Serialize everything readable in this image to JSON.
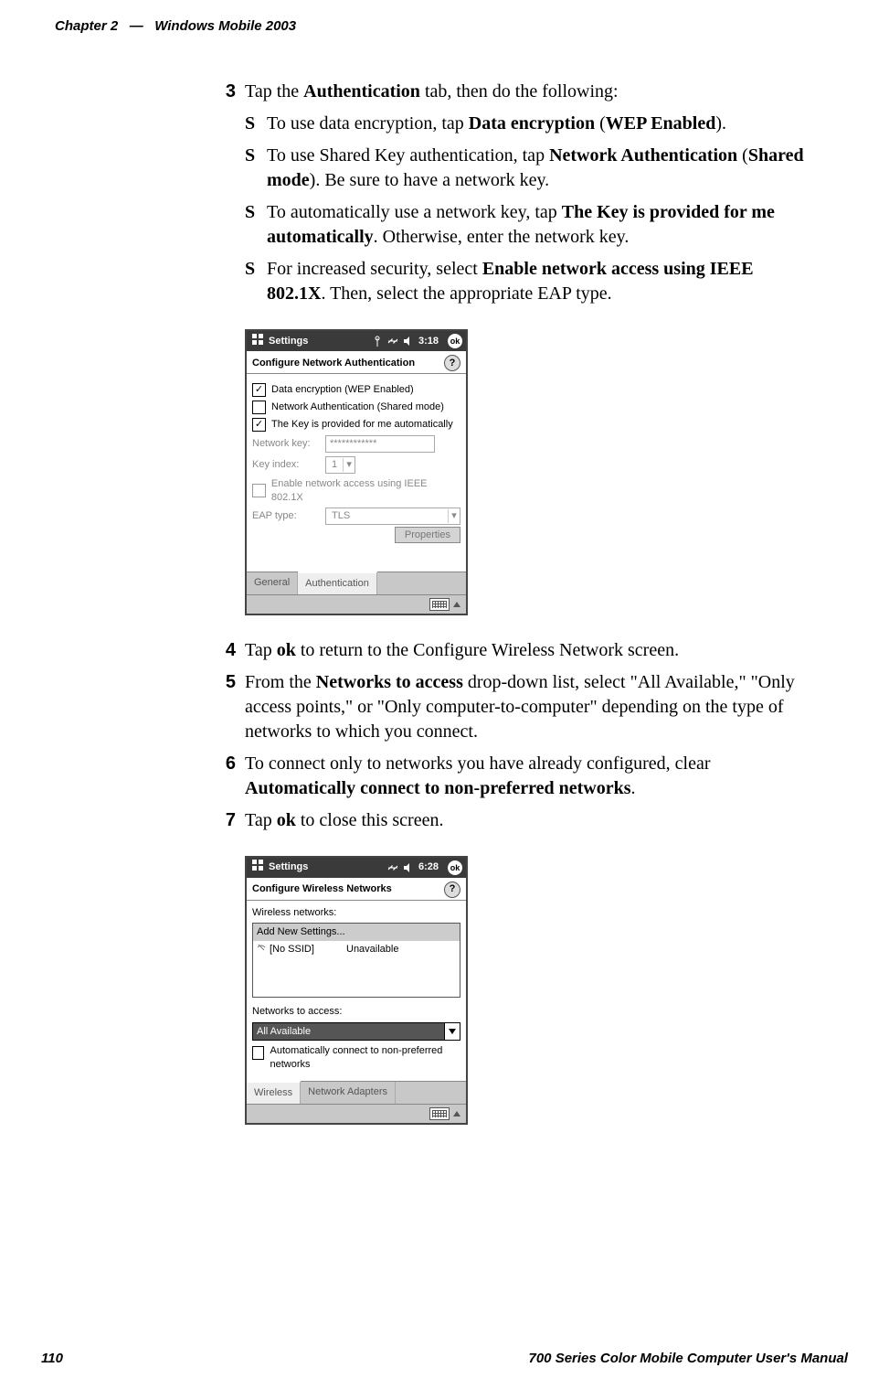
{
  "header": {
    "chapter": "Chapter 2",
    "dash": "—",
    "title": "Windows Mobile 2003"
  },
  "footer": {
    "page": "110",
    "manual": "700 Series Color Mobile Computer User's Manual"
  },
  "steps": {
    "s3": {
      "num": "3",
      "text_a": "Tap the ",
      "text_b": "Authentication",
      "text_c": " tab, then do the following:"
    },
    "s3_sub": {
      "a": {
        "pre": "To use data encryption, tap ",
        "b1": "Data encryption",
        "mid": " (",
        "b2": "WEP Enabled",
        "post": ")."
      },
      "b": {
        "pre": "To use Shared Key authentication, tap ",
        "b1": "Network Authentication",
        "mid": " (",
        "b2": "Shared mode",
        "post": "). Be sure to have a network key."
      },
      "c": {
        "pre": "To automatically use a network key, tap ",
        "b1": "The Key is provided for me automatically",
        "post": ". Otherwise, enter the network key."
      },
      "d": {
        "pre": "For increased security, select ",
        "b1": "Enable network access using IEEE 802.1X",
        "post": ". Then, select the appropriate EAP type."
      }
    },
    "s4": {
      "num": "4",
      "pre": "Tap ",
      "b": "ok",
      "post": " to return to the Configure Wireless Network screen."
    },
    "s5": {
      "num": "5",
      "pre": "From the ",
      "b": "Networks to access",
      "post": " drop-down list, select \"All Available,\" \"Only access points,\" or \"Only computer-to-computer\" depending on the type of networks to which you connect."
    },
    "s6": {
      "num": "6",
      "pre": "To connect only to networks you have already configured, clear ",
      "b": "Automatically connect to non-preferred networks",
      "post": "."
    },
    "s7": {
      "num": "7",
      "pre": "Tap ",
      "b": "ok",
      "post": " to close this screen."
    }
  },
  "shot1": {
    "titlebar": "Settings",
    "time": "3:18",
    "ok": "ok",
    "subheader": "Configure Network Authentication",
    "chk1": "Data encryption (WEP Enabled)",
    "chk2": "Network Authentication (Shared mode)",
    "chk3": "The Key is provided for me automatically",
    "lbl_key": "Network key:",
    "val_key": "************",
    "lbl_idx": "Key index:",
    "val_idx": "1",
    "chk4": "Enable network access using IEEE 802.1X",
    "lbl_eap": "EAP type:",
    "val_eap": "TLS",
    "btn_props": "Properties",
    "tab1": "General",
    "tab2": "Authentication"
  },
  "shot2": {
    "titlebar": "Settings",
    "time": "6:28",
    "ok": "ok",
    "subheader": "Configure Wireless Networks",
    "lbl_list": "Wireless networks:",
    "item1": "Add New Settings...",
    "item2_name": "[No SSID]",
    "item2_status": "Unavailable",
    "lbl_access": "Networks to access:",
    "val_access": "All Available",
    "chk_auto": "Automatically connect to non-preferred networks",
    "tab1": "Wireless",
    "tab2": "Network Adapters"
  }
}
